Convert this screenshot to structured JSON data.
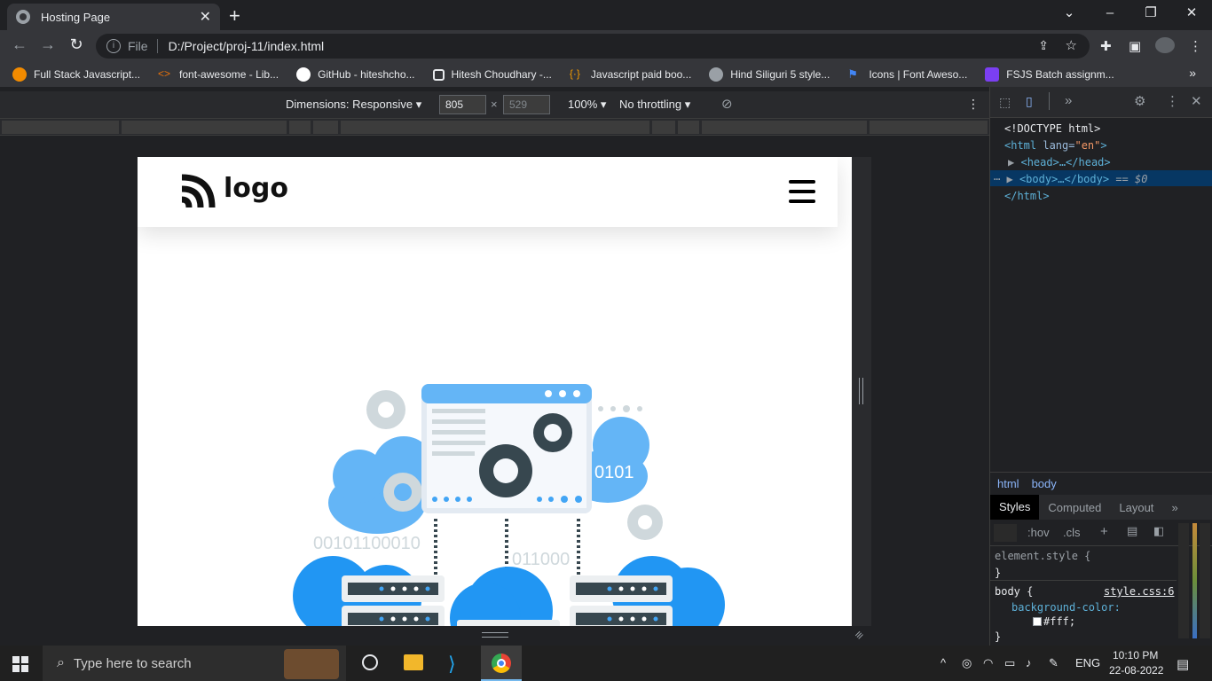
{
  "browser": {
    "tab_title": "Hosting Page",
    "url_scheme": "File",
    "url": "D:/Project/proj-11/index.html",
    "bookmarks": [
      {
        "label": "Full Stack Javascript...",
        "color": "#f28b00"
      },
      {
        "label": "font-awesome - Lib...",
        "color": "#e8710a"
      },
      {
        "label": "GitHub - hiteshcho...",
        "color": "#ffffff"
      },
      {
        "label": "Hitesh Choudhary -...",
        "color": "#e8eaed"
      },
      {
        "label": "Javascript paid boo...",
        "color": "#f29900"
      },
      {
        "label": "Hind Siliguri 5 style...",
        "color": "#9aa0a6"
      },
      {
        "label": "Icons | Font Aweso...",
        "color": "#4285f4"
      },
      {
        "label": "FSJS Batch assignm...",
        "color": "#7b3ff2"
      }
    ]
  },
  "device_toolbar": {
    "dimensions_label": "Dimensions: Responsive",
    "width": "805",
    "height": "529",
    "zoom": "100%",
    "throttling": "No throttling"
  },
  "page": {
    "logo_text": "logo",
    "hero_binary_1": "0101",
    "hero_binary_2": "00101100010",
    "hero_binary_3": "011000"
  },
  "devtools": {
    "dom": {
      "doctype": "<!DOCTYPE html>",
      "html_open_tag": "<html ",
      "html_attr": "lang=",
      "html_attr_val": "\"en\"",
      "html_open_end": ">",
      "head": "<head>…</head>",
      "body": "<body>…</body>",
      "body_suffix": " == $0",
      "html_close": "</html>"
    },
    "crumbs": [
      "html",
      "body"
    ],
    "style_tabs": [
      "Styles",
      "Computed",
      "Layout"
    ],
    "filter_hov": ":hov",
    "filter_cls": ".cls",
    "rules": {
      "element_style": "element.style {",
      "close_brace": "}",
      "body_selector": "body {",
      "source": "style.css:6",
      "property": "background-color:",
      "value": "#fff;"
    }
  },
  "taskbar": {
    "search_placeholder": "Type here to search",
    "lang": "ENG",
    "time": "10:10 PM",
    "date": "22-08-2022"
  },
  "colors": {
    "cloud": "#42a5f5",
    "cloud_light": "#90caf9",
    "gear": "#37474f",
    "gear_light": "#cfd8dc",
    "devtools_selected": "#073763"
  }
}
